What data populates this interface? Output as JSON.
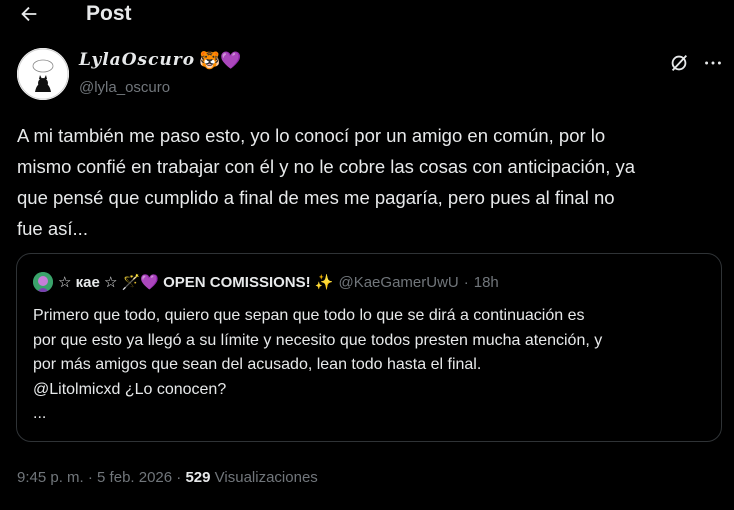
{
  "header": {
    "title": "Post"
  },
  "author": {
    "display_name": "LylaOscuro",
    "badges": "🐯💜",
    "handle": "@lyla_oscuro"
  },
  "post": {
    "lines": [
      "A mi también me paso esto, yo lo conocí por un amigo en común, por lo",
      "mismo confié en trabajar con él y no le cobre las cosas con anticipación, ya",
      "que pensé que cumplido a final de mes me pagaría, pero pues al final no",
      "fue así..."
    ]
  },
  "quote": {
    "display_name": "☆ кae ☆ 🪄💜 OPEN COMISSIONS! ✨",
    "handle": "@KaeGamerUwU",
    "separator": "·",
    "time": "18h",
    "lines": [
      "Primero que todo, quiero que sepan que todo lo que se dirá a continuación es",
      "por que esto ya llegó a su límite y necesito que todos presten mucha atención, y",
      "por más amigos que sean del acusado, lean todo hasta el final.",
      "@Litolmicxd ¿Lo conocen?",
      "..."
    ]
  },
  "meta": {
    "time": "9:45 p. m.",
    "sep1": "·",
    "date": "5 feb. 2026",
    "sep2": "·",
    "views_count": "529",
    "views_label": "Visualizaciones"
  },
  "colors": {
    "background": "#000000",
    "text": "#e7e9ea",
    "muted": "#71767b",
    "border": "#2f3336"
  },
  "icons": {
    "back": "arrow-left-icon",
    "grok": "grok-icon",
    "more": "more-icon"
  }
}
